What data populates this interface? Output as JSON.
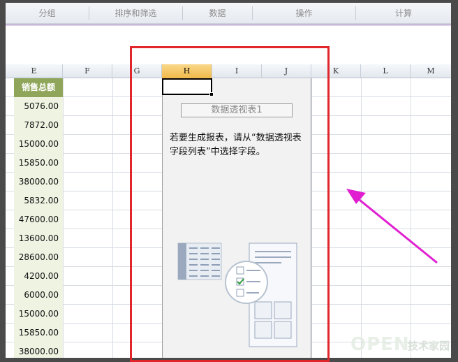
{
  "ribbon": {
    "groups": [
      "分组",
      "排序和筛选",
      "数据",
      "操作",
      "计算"
    ]
  },
  "columns": [
    "E",
    "F",
    "G",
    "H",
    "I",
    "J",
    "K",
    "L",
    "M"
  ],
  "active_column": "H",
  "sheet": {
    "header": "销售总额",
    "values": [
      "5076.00",
      "7872.00",
      "15000.00",
      "15850.00",
      "38000.00",
      "5832.00",
      "47600.00",
      "13600.00",
      "28600.00",
      "4200.00",
      "6000.00",
      "15000.00",
      "15850.00",
      "38000.00"
    ]
  },
  "pivot": {
    "title": "数据透视表1",
    "message": "若要生成报表，请从“数据透视表字段列表”中选择字段。"
  },
  "annotation": {
    "highlight_color": "#e0262b",
    "arrow_color": "#e020d0"
  },
  "watermark": {
    "brand": "OPEN",
    "suffix": "技术家园"
  }
}
